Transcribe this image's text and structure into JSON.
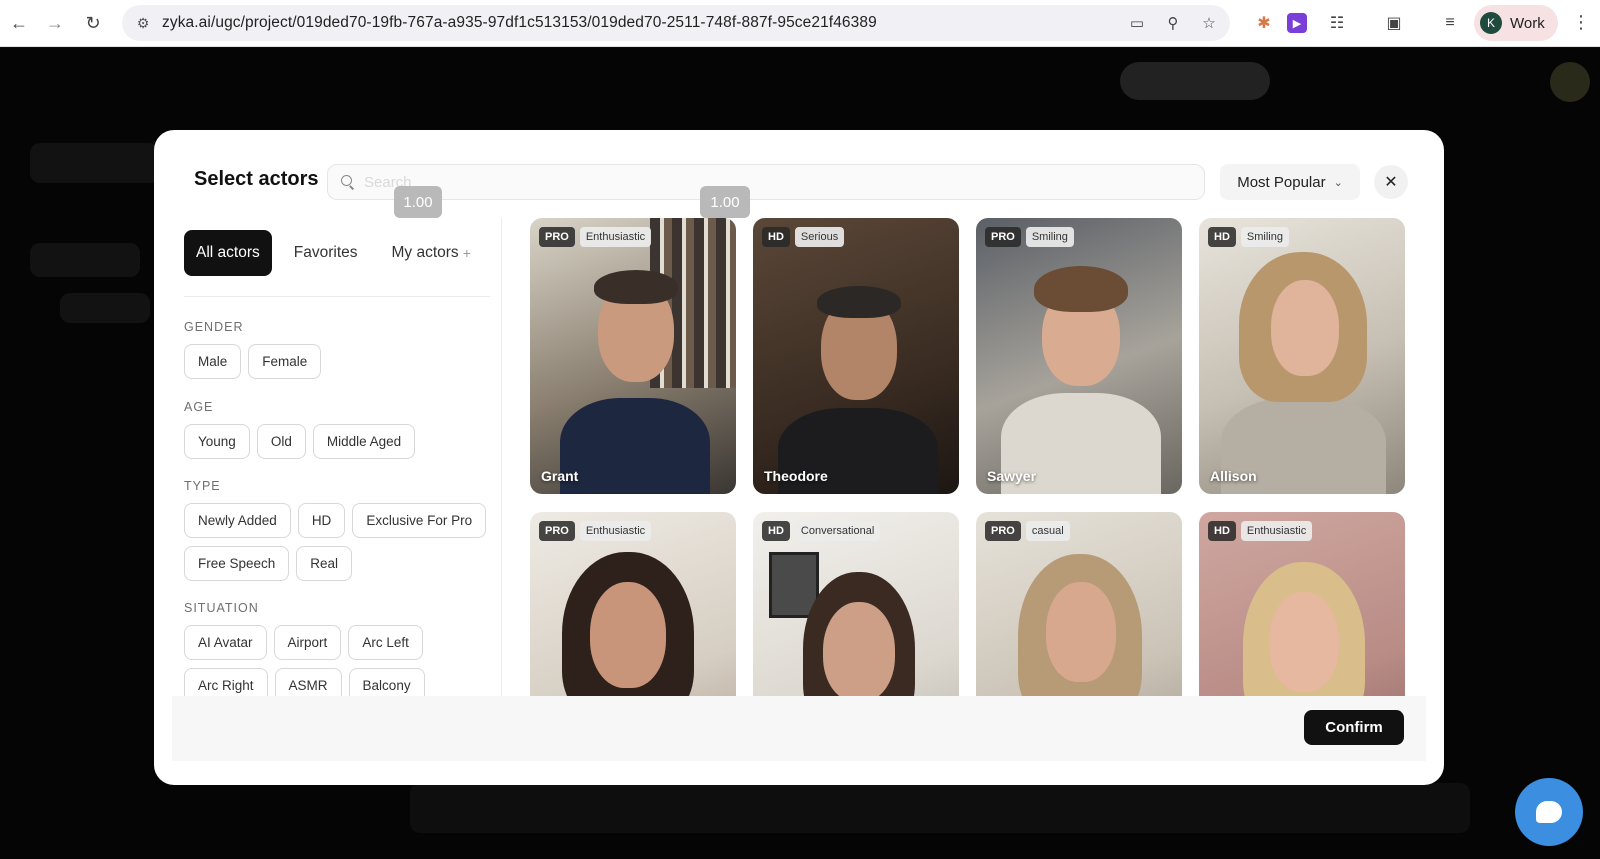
{
  "browser": {
    "url": "zyka.ai/ugc/project/019ded70-19fb-767a-a935-97df1c513153/019ded70-2511-748f-887f-95ce21f46389",
    "profile_initial": "K",
    "profile_label": "Work"
  },
  "modal": {
    "title": "Select actors",
    "search_placeholder": "Search",
    "sort_label": "Most Popular",
    "tooltips": [
      "1.00",
      "1.00"
    ],
    "tabs": [
      {
        "label": "All actors"
      },
      {
        "label": "Favorites"
      },
      {
        "label": "My actors",
        "suffix": "+"
      }
    ],
    "filters": {
      "gender": {
        "label": "GENDER",
        "options": [
          "Male",
          "Female"
        ]
      },
      "age": {
        "label": "AGE",
        "options": [
          "Young",
          "Old",
          "Middle Aged"
        ]
      },
      "type": {
        "label": "TYPE",
        "options": [
          "Newly Added",
          "HD",
          "Exclusive For Pro",
          "Free Speech",
          "Real"
        ]
      },
      "situation": {
        "label": "SITUATION",
        "options": [
          "AI Avatar",
          "Airport",
          "Arc Left",
          "Arc Right",
          "ASMR",
          "Balcony"
        ]
      }
    },
    "actors": [
      {
        "name": "Grant",
        "tier": "PRO",
        "tone": "Enthusiastic"
      },
      {
        "name": "Theodore",
        "tier": "HD",
        "tone": "Serious"
      },
      {
        "name": "Sawyer",
        "tier": "PRO",
        "tone": "Smiling"
      },
      {
        "name": "Allison",
        "tier": "HD",
        "tone": "Smiling"
      },
      {
        "name": "",
        "tier": "PRO",
        "tone": "Enthusiastic"
      },
      {
        "name": "",
        "tier": "HD",
        "tone": "Conversational"
      },
      {
        "name": "",
        "tier": "PRO",
        "tone": "casual"
      },
      {
        "name": "",
        "tier": "HD",
        "tone": "Enthusiastic"
      }
    ],
    "confirm_label": "Confirm"
  },
  "colors": {
    "primary": "#111111",
    "chat_button": "#3b8ee0",
    "overlay": "#0a0a0a"
  }
}
